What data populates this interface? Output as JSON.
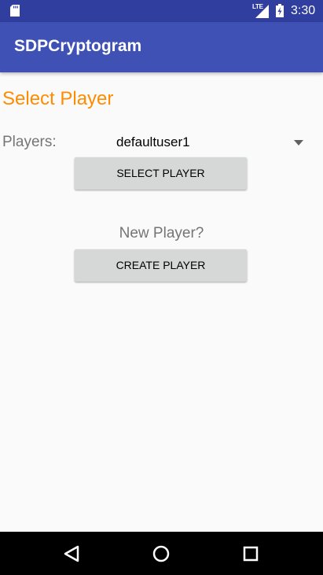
{
  "status_bar": {
    "network_label": "LTE",
    "time": "3:30",
    "icons": [
      "sd-card-icon",
      "signal-icon",
      "battery-charging-icon"
    ]
  },
  "app_bar": {
    "title": "SDPCryptogram"
  },
  "main": {
    "title": "Select Player",
    "players_label": "Players:",
    "selected_player": "defaultuser1",
    "select_button_label": "SELECT PLAYER",
    "new_player_prompt": "New Player?",
    "create_button_label": "CREATE PLAYER"
  },
  "nav_bar": {
    "icons": [
      "back-icon",
      "home-icon",
      "recents-icon"
    ]
  },
  "colors": {
    "status_bar": "#303F9F",
    "app_bar": "#3F51B5",
    "accent": "#FF8C00",
    "secondary_text": "#757575",
    "button": "#D6D7D7",
    "background": "#FAFAFA"
  }
}
